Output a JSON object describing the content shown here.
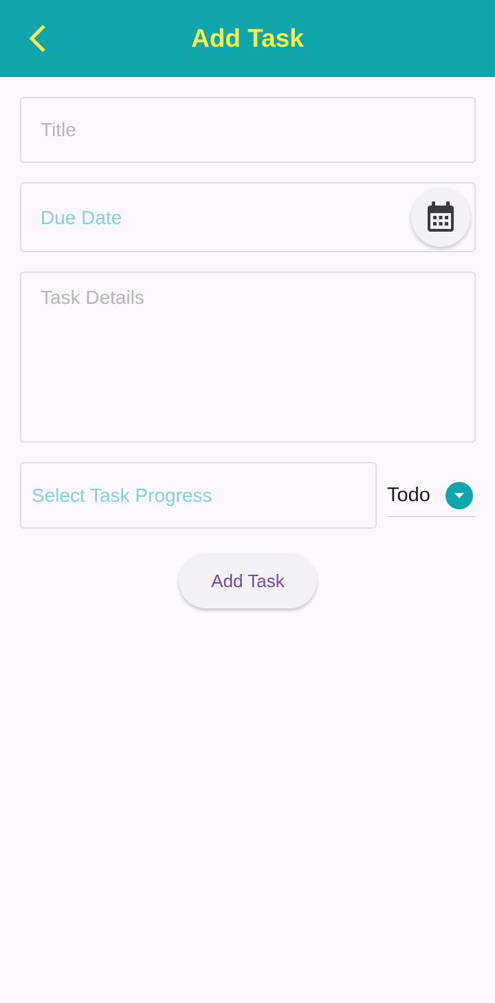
{
  "app_bar": {
    "title": "Add Task",
    "back_icon": "chevron-left-icon",
    "background_color": "#10a5aa",
    "title_color": "#f3f04a"
  },
  "form": {
    "title_field": {
      "placeholder": "Title",
      "value": ""
    },
    "due_date_field": {
      "label": "Due Date",
      "value": "",
      "picker_icon": "calendar-icon"
    },
    "details_field": {
      "placeholder": "Task Details",
      "value": ""
    },
    "progress_field": {
      "label": "Select Task Progress"
    },
    "progress_dropdown": {
      "selected": "Todo",
      "icon": "arrow-drop-down-icon"
    },
    "submit_label": "Add Task"
  },
  "colors": {
    "accent": "#10a5aa",
    "label_teal": "#86d1d1",
    "button_text": "#6b4e9e"
  }
}
